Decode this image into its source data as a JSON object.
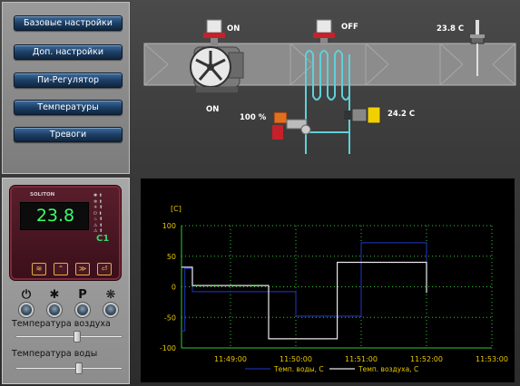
{
  "menu": {
    "items": [
      {
        "label": "Базовые настройки"
      },
      {
        "label": "Доп. настройки"
      },
      {
        "label": "Пи-Регулятор"
      },
      {
        "label": "Температуры"
      },
      {
        "label": "Тревоги"
      }
    ]
  },
  "diagram": {
    "fan_valve_status": "ON",
    "heater_valve_status": "OFF",
    "fan_status": "ON",
    "damper_percent": "100 %",
    "water_temp": "24.2 C",
    "air_temp": "23.8 C"
  },
  "controller": {
    "brand": "SOLITON",
    "display_value": "23.8",
    "model": "C1",
    "keys": [
      "≋",
      "⌃",
      "≫",
      "⏎"
    ],
    "knob_symbols": [
      "⏻",
      "✱",
      "P",
      "❋"
    ],
    "air_temp_slider": {
      "label": "Температура воздуха",
      "value": 0.58
    },
    "water_temp_slider": {
      "label": "Температура воды",
      "value": 0.6
    }
  },
  "chart_data": {
    "type": "line",
    "ylabel": "[C]",
    "ylim": [
      -100,
      100
    ],
    "yticks": [
      "100",
      "50",
      "0",
      "-50",
      "-100"
    ],
    "xticks": [
      "11:49:00",
      "11:50:00",
      "11:51:00",
      "11:52:00",
      "11:53:00"
    ],
    "grid": true,
    "legend_position": "bottom",
    "series": [
      {
        "name": "Темп. воды, С",
        "color": "#1a2ea0",
        "x": [
          "11:48:15",
          "11:48:18",
          "11:48:18",
          "11:48:25",
          "11:48:25",
          "11:50:00",
          "11:50:00",
          "11:51:00",
          "11:51:00",
          "11:52:00",
          "11:52:00"
        ],
        "y": [
          -72,
          -72,
          30,
          30,
          -8,
          -8,
          -48,
          -48,
          72,
          72,
          10
        ]
      },
      {
        "name": "Темп. воздуха, С",
        "color": "#e8e8e8",
        "x": [
          "11:48:15",
          "11:48:25",
          "11:48:25",
          "11:49:35",
          "11:49:35",
          "11:50:38",
          "11:50:38",
          "11:52:00",
          "11:52:00"
        ],
        "y": [
          32,
          32,
          2,
          2,
          -85,
          -85,
          40,
          40,
          -10
        ]
      }
    ]
  },
  "colors": {
    "chart_axis": "#2ecc2e",
    "chart_labels": "#e8c800",
    "water_series": "#1a2ea0",
    "air_series": "#e8e8e8"
  }
}
